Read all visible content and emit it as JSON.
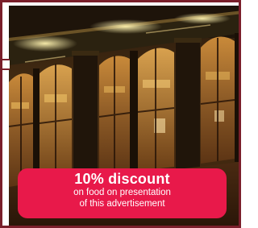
{
  "advertisement": {
    "photo_subject": "restaurant-storefront-photo",
    "colors": {
      "frame": "#7a1f2b",
      "promo_background": "#e8194a",
      "promo_text": "#ffffff"
    },
    "promo": {
      "headline": "10% discount",
      "line1": "on food on presentation",
      "line2": "of this advertisement"
    }
  }
}
